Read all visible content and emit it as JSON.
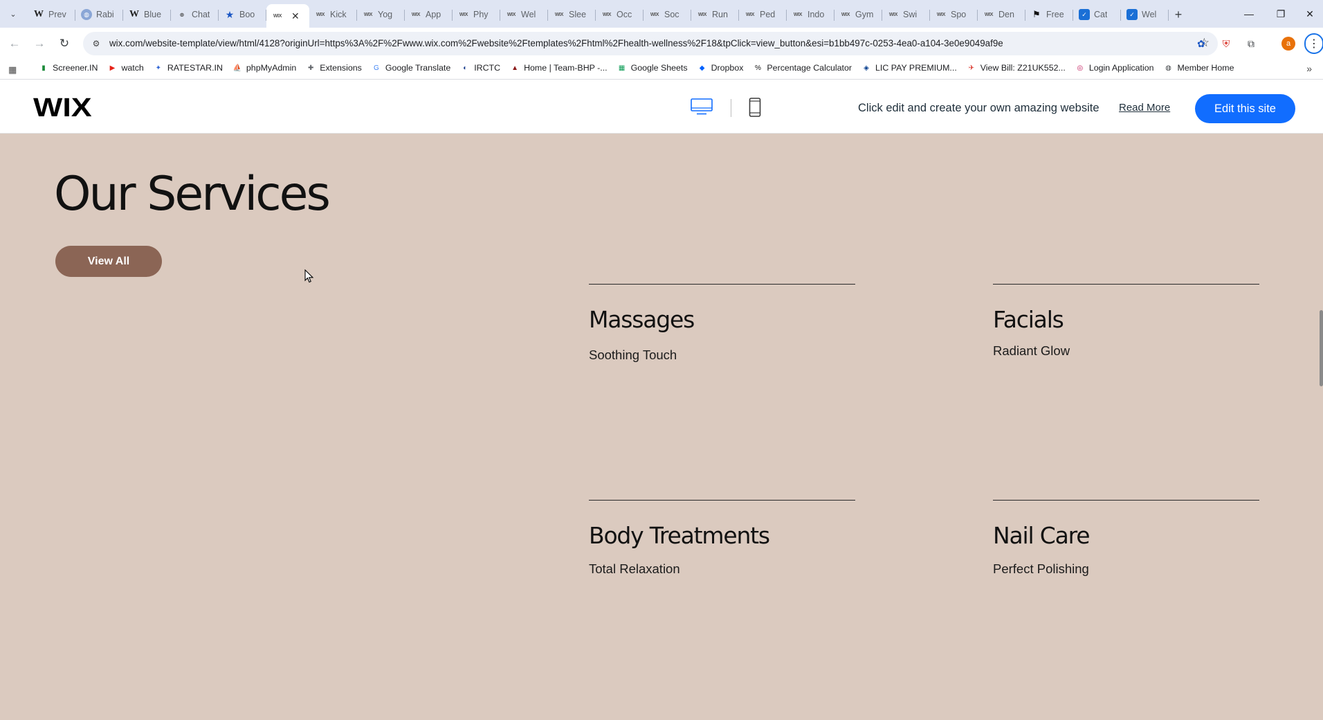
{
  "browser": {
    "tabs": [
      {
        "title": "Prev",
        "icon": "W",
        "icon_name": "wikipedia-icon"
      },
      {
        "title": "Rabi",
        "icon": "◍",
        "icon_name": "globe-icon"
      },
      {
        "title": "Blue",
        "icon": "W",
        "icon_name": "wikipedia-icon"
      },
      {
        "title": "Chat",
        "icon": "⊛",
        "icon_name": "chatgpt-icon"
      },
      {
        "title": "Boo",
        "icon": "★",
        "icon_name": "bookmark-star-icon"
      },
      {
        "title": "",
        "icon": "WIX",
        "icon_name": "wix-icon",
        "active": true
      },
      {
        "title": "Kick",
        "icon": "WIX",
        "icon_name": "wix-icon"
      },
      {
        "title": "Yog",
        "icon": "WIX",
        "icon_name": "wix-icon"
      },
      {
        "title": "App",
        "icon": "WIX",
        "icon_name": "wix-icon"
      },
      {
        "title": "Phy",
        "icon": "WIX",
        "icon_name": "wix-icon"
      },
      {
        "title": "Wel",
        "icon": "WIX",
        "icon_name": "wix-icon"
      },
      {
        "title": "Slee",
        "icon": "WIX",
        "icon_name": "wix-icon"
      },
      {
        "title": "Occ",
        "icon": "WIX",
        "icon_name": "wix-icon"
      },
      {
        "title": "Soc",
        "icon": "WIX",
        "icon_name": "wix-icon"
      },
      {
        "title": "Run",
        "icon": "WIX",
        "icon_name": "wix-icon"
      },
      {
        "title": "Ped",
        "icon": "WIX",
        "icon_name": "wix-icon"
      },
      {
        "title": "Indo",
        "icon": "WIX",
        "icon_name": "wix-icon"
      },
      {
        "title": "Gym",
        "icon": "WIX",
        "icon_name": "wix-icon"
      },
      {
        "title": "Swi",
        "icon": "WIX",
        "icon_name": "wix-icon"
      },
      {
        "title": "Spo",
        "icon": "WIX",
        "icon_name": "wix-icon"
      },
      {
        "title": "Den",
        "icon": "WIX",
        "icon_name": "wix-icon"
      },
      {
        "title": "Free",
        "icon": "⚑",
        "icon_name": "framer-icon"
      },
      {
        "title": "Cat",
        "icon": "✓",
        "icon_name": "site-icon"
      },
      {
        "title": "Wel",
        "icon": "✓",
        "icon_name": "site-icon"
      }
    ],
    "new_tab": "+",
    "window": {
      "minimize": "—",
      "restore": "❐",
      "close": "✕"
    },
    "url": "wix.com/website-template/view/html/4128?originUrl=https%3A%2F%2Fwww.wix.com%2Fwebsite%2Ftemplates%2Fhtml%2Fhealth-wellness%2F18&tpClick=view_button&esi=b1bb497c-0253-4ea0-a104-3e0e9049af9e",
    "profile_initial": "a",
    "bookmarks": [
      {
        "label": "Screener.IN",
        "icon": "▮",
        "color": "#1c8a3a"
      },
      {
        "label": "watch",
        "icon": "▶",
        "color": "#e62117"
      },
      {
        "label": "RATESTAR.IN",
        "icon": "✦",
        "color": "#3367d6"
      },
      {
        "label": "phpMyAdmin",
        "icon": "⛵",
        "color": "#e07b00"
      },
      {
        "label": "Extensions",
        "icon": "✚",
        "color": "#5f6368"
      },
      {
        "label": "Google Translate",
        "icon": "G",
        "color": "#4285f4"
      },
      {
        "label": "IRCTC",
        "icon": "◐",
        "color": "#1a3e8c"
      },
      {
        "label": "Home | Team-BHP -...",
        "icon": "▲",
        "color": "#8b1a1a"
      },
      {
        "label": "Google Sheets",
        "icon": "▦",
        "color": "#0f9d58"
      },
      {
        "label": "Dropbox",
        "icon": "◆",
        "color": "#0061fe"
      },
      {
        "label": "Percentage Calculator",
        "icon": "%",
        "color": "#111111"
      },
      {
        "label": "LIC PAY PREMIUM...",
        "icon": "◈",
        "color": "#003a8c"
      },
      {
        "label": "View Bill: Z21UK552...",
        "icon": "✈",
        "color": "#d93025"
      },
      {
        "label": "Login Application",
        "icon": "◎",
        "color": "#c2185b"
      },
      {
        "label": "Member Home",
        "icon": "◍",
        "color": "#3c4043"
      }
    ]
  },
  "wix_bar": {
    "logo": "WIX",
    "cta_text": "Click edit and create your own amazing website",
    "read_more": "Read More",
    "edit_button": "Edit this site",
    "accent": "#116dff"
  },
  "page": {
    "heading": "Our Services",
    "view_all": "View All",
    "button_color": "#8b6555",
    "background": "#dbcabf",
    "services": [
      {
        "name": "Massages",
        "tagline": "Soothing Touch"
      },
      {
        "name": "Facials",
        "tagline": "Radiant Glow"
      },
      {
        "name": "Body Treatments",
        "tagline": "Total Relaxation"
      },
      {
        "name": "Nail Care",
        "tagline": "Perfect Polishing"
      }
    ]
  }
}
